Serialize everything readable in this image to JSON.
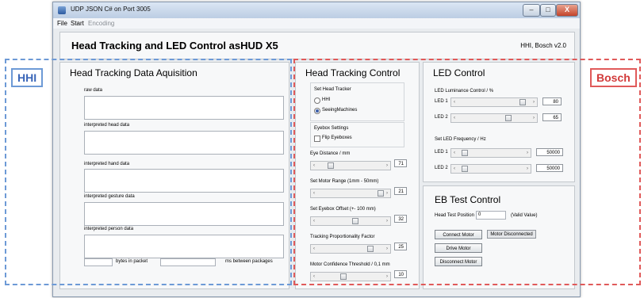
{
  "window": {
    "title": "UDP JSON C# on Port 3005",
    "buttons": {
      "minimize": "–",
      "maximize": "□",
      "close": "X"
    }
  },
  "menu": {
    "file": "File",
    "start": "Start",
    "encoding": "Encoding"
  },
  "header": {
    "title": "Head Tracking and LED Control asHUD X5",
    "version": "HHI, Bosch v2.0"
  },
  "acquisition": {
    "title": "Head Tracking Data Aquisition",
    "raw_label": "raw data",
    "head_label": "interpreted head data",
    "hand_label": "interpreted hand data",
    "gesture_label": "interpreted gesture data",
    "person_label": "interpreted person data",
    "bytes_label": "bytes in packet",
    "ms_label": "ms between packages"
  },
  "head_tracking": {
    "title": "Head Tracking Control",
    "set_tracker_label": "Set Head Tracker",
    "radio_hhi": "HHI",
    "radio_seeing": "SeeingMachines",
    "eyebox_settings_label": "Eyebox Settings",
    "flip_eyeboxes_label": "Flip Eyeboxes",
    "sliders": [
      {
        "label": "Eye Distance / mm",
        "value": "71",
        "level": 0.12
      },
      {
        "label": "Set Motor Range (1mm - 50mm)",
        "value": "21",
        "level": 1.0
      },
      {
        "label": "Set Eyebox Offset (+- 100 mm)",
        "value": "32",
        "level": 0.55
      },
      {
        "label": "Tracking Proportionality Factor",
        "value": "25",
        "level": 0.82
      },
      {
        "label": "Motor Confidence Threshold / 0,1 mm",
        "value": "10",
        "level": 0.35
      }
    ]
  },
  "led": {
    "title": "LED Control",
    "luminance_label": "LED Luminance Control / %",
    "frequency_label": "Set LED Frequency / Hz",
    "luminance": [
      {
        "label": "LED 1",
        "value": "80",
        "level": 0.92
      },
      {
        "label": "LED 2",
        "value": "65",
        "level": 0.7
      }
    ],
    "frequency": [
      {
        "label": "LED 1",
        "value": "50000",
        "level": 0.02
      },
      {
        "label": "LED 2",
        "value": "50000",
        "level": 0.02
      }
    ]
  },
  "eb_test": {
    "title": "EB Test Control",
    "head_test_label": "Head Test Position",
    "head_test_value": "0",
    "valid_label": "(Valid Value)",
    "connect_button": "Connect Motor",
    "status": "Motor Disconnected",
    "drive_button": "Drive Motor",
    "disconnect_button": "Disconnect Motor"
  },
  "overlay": {
    "left_tag": "HHI",
    "right_tag": "Bosch",
    "blue": "#6d9ad6",
    "red": "#e05a5a",
    "tag_blue": "#3a66b8",
    "tag_red": "#d23a3a"
  }
}
